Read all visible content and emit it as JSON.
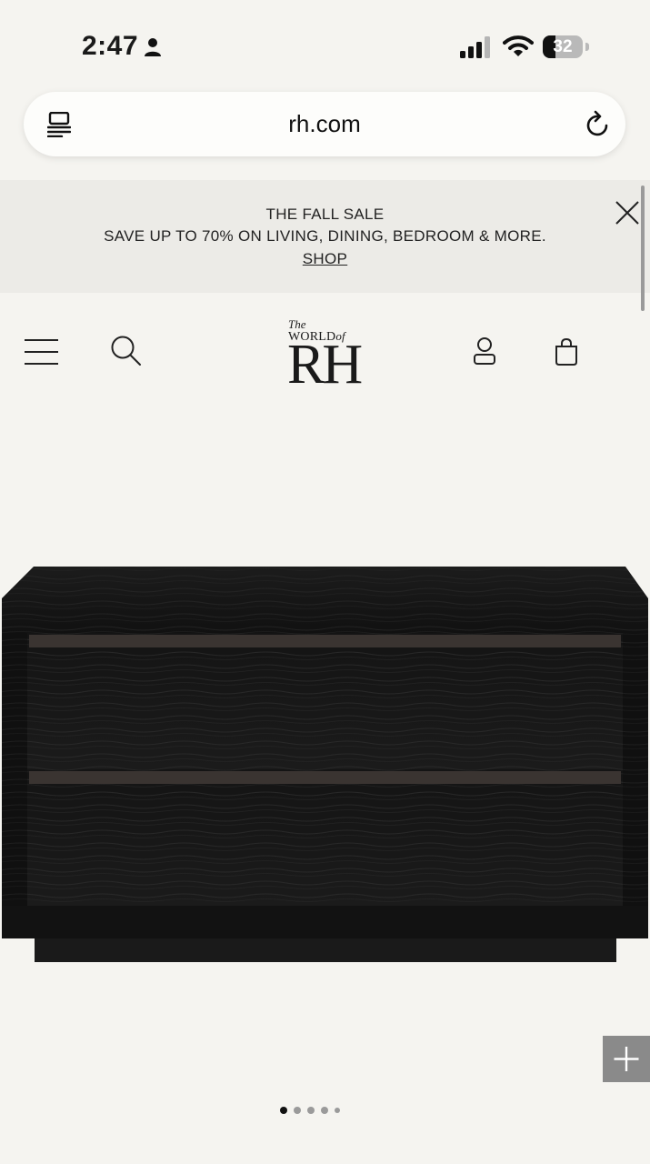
{
  "status_bar": {
    "time": "2:47",
    "battery_percent": "32",
    "battery_level": 0.32
  },
  "browser": {
    "url": "rh.com"
  },
  "promo": {
    "title": "THE FALL SALE",
    "subtitle": "SAVE UP TO 70% ON LIVING, DINING, BEDROOM & MORE.",
    "link_label": "SHOP"
  },
  "header": {
    "logo": {
      "the": "The",
      "world": "WORLD",
      "of": "of",
      "brand": "RH"
    },
    "icons": [
      "menu-icon",
      "search-icon",
      "account-icon",
      "bag-icon"
    ]
  },
  "product": {
    "image_icon": "dark-oak-nightstand-image"
  },
  "gallery": {
    "total_images": 5,
    "active_index": 0
  },
  "colors": {
    "background": "#f5f4f0",
    "promo_background": "#ecebe7",
    "zoom_button": "#8a8a8a"
  }
}
